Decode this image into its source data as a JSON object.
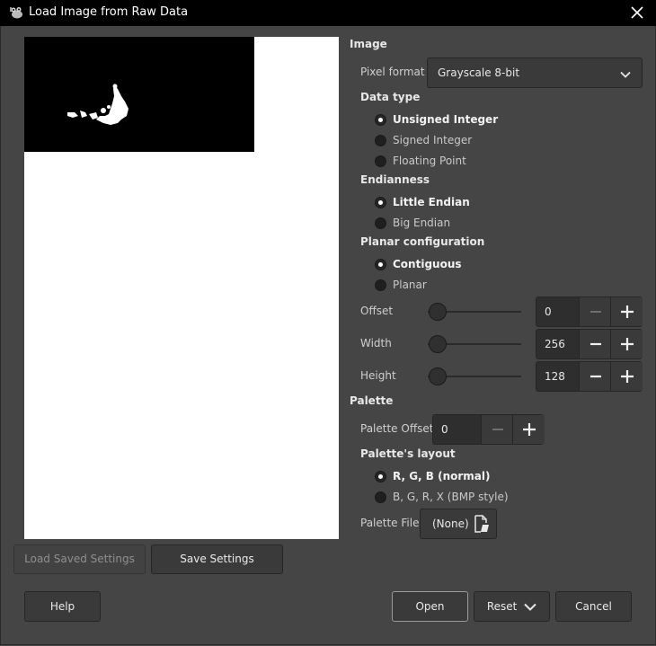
{
  "window": {
    "title": "Load Image from Raw Data"
  },
  "sections": {
    "image": "Image",
    "data_type": "Data type",
    "endianness": "Endianness",
    "planar": "Planar configuration",
    "palette": "Palette",
    "palette_layout": "Palette's layout"
  },
  "pixel_format": {
    "label": "Pixel format",
    "value": "Grayscale 8-bit"
  },
  "data_type": {
    "options": [
      "Unsigned Integer",
      "Signed Integer",
      "Floating Point"
    ],
    "selected": "Unsigned Integer"
  },
  "endianness": {
    "options": [
      "Little Endian",
      "Big Endian"
    ],
    "selected": "Little Endian"
  },
  "planar": {
    "options": [
      "Contiguous",
      "Planar"
    ],
    "selected": "Contiguous"
  },
  "offset": {
    "label": "Offset",
    "value": "0"
  },
  "width": {
    "label": "Width",
    "value": "256"
  },
  "height": {
    "label": "Height",
    "value": "128"
  },
  "palette_offset": {
    "label": "Palette Offset",
    "value": "0"
  },
  "palette_layout": {
    "options": [
      "R, G, B (normal)",
      "B, G, R, X (BMP style)"
    ],
    "selected": "R, G, B (normal)"
  },
  "palette_file": {
    "label": "Palette File",
    "value": "(None)"
  },
  "buttons": {
    "load_saved": "Load Saved Settings",
    "save_settings": "Save Settings",
    "help": "Help",
    "open": "Open",
    "reset": "Reset",
    "cancel": "Cancel"
  },
  "icons": {
    "app": "gimp-wilber-icon",
    "close": "close-icon",
    "dropdown": "chevron-down-icon",
    "file": "file-open-icon"
  }
}
